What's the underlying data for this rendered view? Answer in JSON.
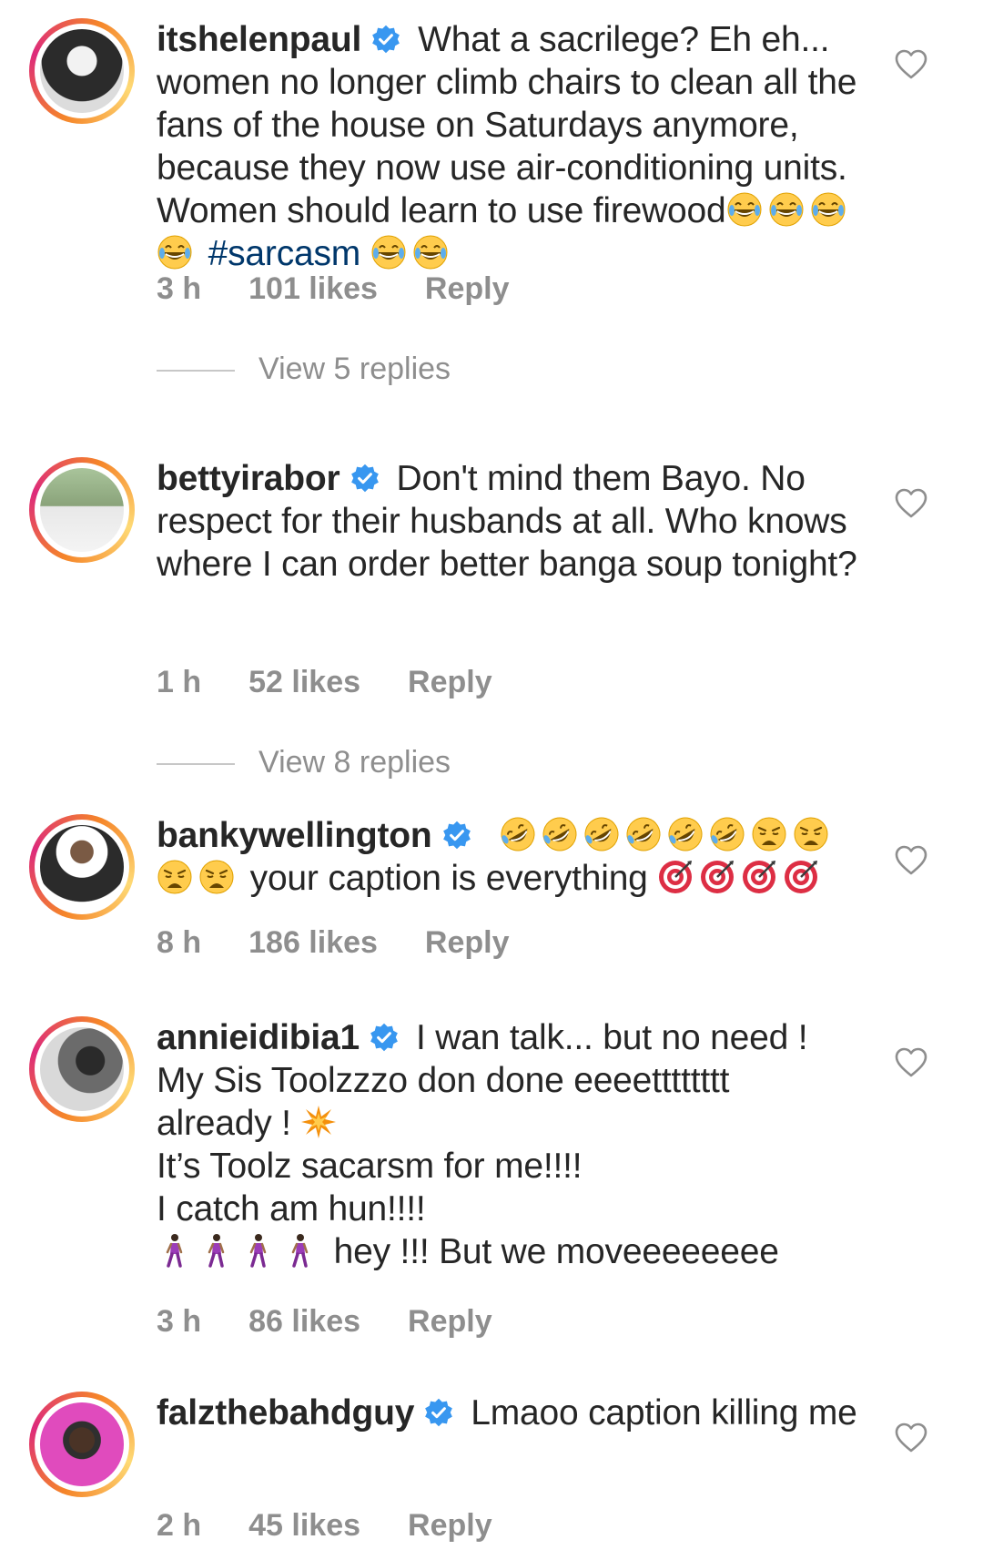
{
  "comments": [
    {
      "username": "itshelenpaul",
      "text_before_emoji": "What a sacrilege? Eh eh... women no longer climb chairs to clean all the fans of the house on Saturdays anymore, because they now use air-conditioning units.  Women should learn to use firewood",
      "hashtag": "#sarcasm",
      "time": "3 h",
      "likes": "101 likes",
      "reply": "Reply",
      "view_replies": "View 5 replies",
      "avatar_color": "#2b2b2b"
    },
    {
      "username": "bettyirabor",
      "text": "Don't mind them Bayo. No respect for their husbands at all. Who knows where I can order better banga soup tonight?",
      "time": "1 h",
      "likes": "52 likes",
      "reply": "Reply",
      "view_replies": "View 8 replies",
      "avatar_color": "#8aa37a"
    },
    {
      "username": "bankywellington",
      "text": "your caption is everything",
      "time": "8 h",
      "likes": "186 likes",
      "reply": "Reply",
      "avatar_color": "#3a3a3a"
    },
    {
      "username": "annieidibia1",
      "line1": "I wan talk... but no need !",
      "line2": "My Sis Toolzzzo don done eeeetttttttt",
      "line3": "already !",
      "line4": "It’s Toolz sacarsm for me!!!!",
      "line5": "I catch am hun!!!!",
      "line6": "hey !!! But we moveeeeeeee",
      "time": "3 h",
      "likes": "86 likes",
      "reply": "Reply",
      "avatar_color": "#4a4a4a"
    },
    {
      "username": "falzthebahdguy",
      "text": "Lmaoo caption killing me",
      "time": "2 h",
      "likes": "45 likes",
      "reply": "Reply",
      "avatar_color": "#e04bbd"
    }
  ],
  "colors": {
    "text": "#262626",
    "meta": "#8e8e8e",
    "hashtag": "#00376b",
    "verified": "#3897f0"
  },
  "icons": {
    "verified": "verified-badge-icon",
    "like": "heart-outline-icon",
    "emoji_laugh": "grinning-squinting-face-emoji",
    "emoji_rofl": "rolling-on-floor-laughing-emoji",
    "emoji_weary": "weary-face-emoji",
    "emoji_target": "direct-hit-emoji",
    "emoji_boom": "collision-emoji",
    "emoji_walk": "woman-walking-emoji"
  }
}
